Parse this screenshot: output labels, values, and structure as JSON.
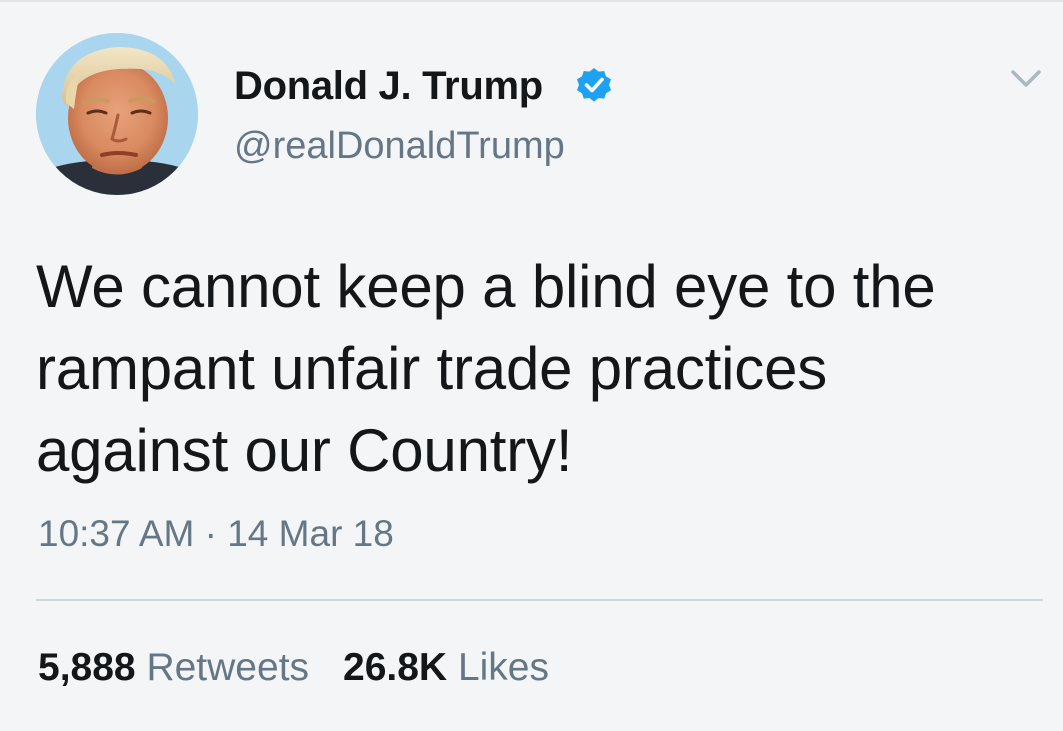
{
  "tweet": {
    "display_name": "Donald J. Trump",
    "handle": "@realDonaldTrump",
    "verified": true,
    "text_lines": [
      "We cannot keep a blind eye to the",
      "rampant unfair trade practices",
      "against our Country!"
    ],
    "time": "10:37 AM",
    "separator": "·",
    "date": "14 Mar 18",
    "retweets_count": "5,888",
    "retweets_label": "Retweets",
    "likes_count": "26.8K",
    "likes_label": "Likes"
  },
  "icons": {
    "verified": "verified-badge-icon",
    "menu": "chevron-down-icon",
    "avatar": "profile-photo"
  },
  "colors": {
    "background": "#f4f5f7",
    "text": "#14171a",
    "secondary_text": "#657786",
    "verified_blue": "#1da1f2",
    "divider": "#ccd6dd"
  }
}
